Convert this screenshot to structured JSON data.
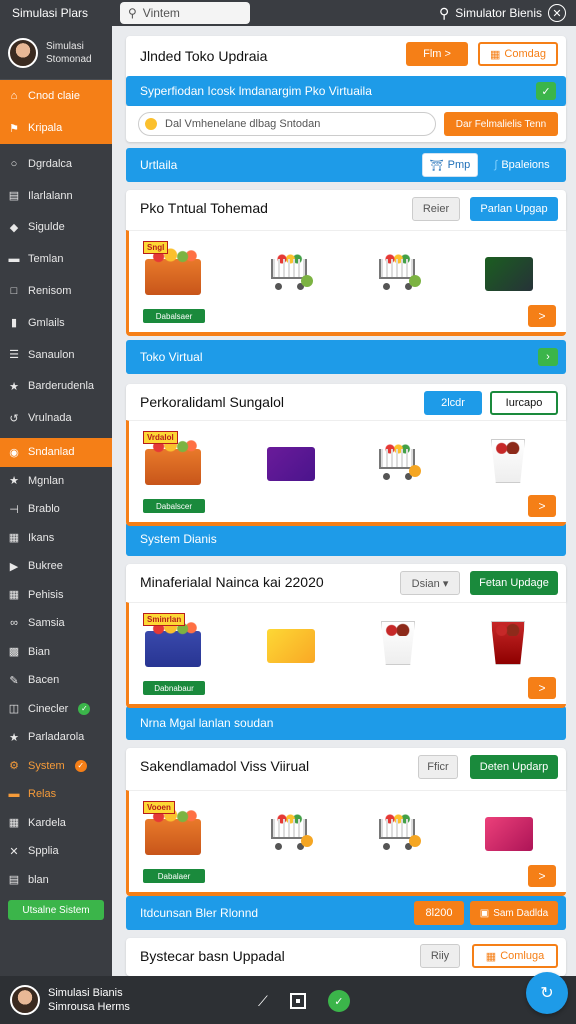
{
  "topbar": {
    "app_title": "Simulasi Plars",
    "search_value": "Vintem",
    "right_label": "Simulator Bienis"
  },
  "sidebar": {
    "profile_name": "Simulasi\nStomonad",
    "items": [
      {
        "label": "Cnod claie",
        "icon": "home-icon",
        "style": "orange"
      },
      {
        "label": "Kripala",
        "icon": "flag-icon",
        "style": "orange"
      },
      {
        "label": "Dgrdalca",
        "icon": "circle-icon",
        "style": ""
      },
      {
        "label": "Ilarlalann",
        "icon": "document-icon",
        "style": ""
      },
      {
        "label": "Sigulde",
        "icon": "tag-icon",
        "style": ""
      },
      {
        "label": "Temlan",
        "icon": "card-icon",
        "style": ""
      },
      {
        "label": "Renisom",
        "icon": "square-icon",
        "style": ""
      },
      {
        "label": "Gmlails",
        "icon": "bars-icon",
        "style": ""
      },
      {
        "label": "Sanaulon",
        "icon": "list-icon",
        "style": ""
      },
      {
        "label": "Barderudenla",
        "icon": "star-icon",
        "style": ""
      },
      {
        "label": "Vrulnada",
        "icon": "share-icon",
        "style": ""
      },
      {
        "label": "Sndanlad",
        "icon": "shield-icon",
        "style": "orange-sel"
      },
      {
        "label": "Mgnlan",
        "icon": "star-icon",
        "style": ""
      },
      {
        "label": "Brablo",
        "icon": "bracket-icon",
        "style": ""
      },
      {
        "label": "Ikans",
        "icon": "building-icon",
        "style": ""
      },
      {
        "label": "Bukree",
        "icon": "play-icon",
        "style": ""
      },
      {
        "label": "Pehisis",
        "icon": "grid-icon",
        "style": ""
      },
      {
        "label": "Samsia",
        "icon": "link-icon",
        "style": ""
      },
      {
        "label": "Bian",
        "icon": "chart-icon",
        "style": ""
      },
      {
        "label": "Bacen",
        "icon": "edit-icon",
        "style": ""
      },
      {
        "label": "Cinecler",
        "icon": "window-icon",
        "style": "green-dot"
      },
      {
        "label": "Parladarola",
        "icon": "star-icon",
        "style": ""
      },
      {
        "label": "System",
        "icon": "gear-icon",
        "style": "orange-dot"
      },
      {
        "label": "Relas",
        "icon": "card-icon",
        "style": "orange-text"
      },
      {
        "label": "Kardela",
        "icon": "building-icon",
        "style": ""
      },
      {
        "label": "Spplia",
        "icon": "x-icon",
        "style": ""
      },
      {
        "label": "blan",
        "icon": "document-icon",
        "style": ""
      }
    ],
    "bottom_button": "Utsalne Sistem"
  },
  "header_card": {
    "title": "Jlnded Toko Updraia",
    "btn_film": "Flm  >",
    "btn_comdag": "Comdag",
    "banner": "Syperfiodan Icosk lmdanargim Pko Virtuaila",
    "input_placeholder": "Dal Vmhenelane dlbag Sntodan",
    "input_button": "Dar Felmalielis Tenn"
  },
  "sections": [
    {
      "bar": "Urtlaila",
      "bar_btn1": "Pmp",
      "bar_btn2": "Bpaleions",
      "title": "Pko Tntual Tohemad",
      "btn_a": "Reier",
      "btn_b": "Parlan Upgap",
      "crate_tag": "Sngl",
      "label": "Dabalsaer",
      "next": ">"
    },
    {
      "bar": "Toko Virtual",
      "bar_btn1": "",
      "bar_btn2": "",
      "title": "Perkoralidaml Sungalol",
      "btn_a": "2lcdr",
      "btn_b": "Iurcapo",
      "crate_tag": "Vrdalol",
      "label": "Dabalscer",
      "next": ">"
    },
    {
      "bar": "System Dianis",
      "bar_btn1": "",
      "bar_btn2": "",
      "title": "Minaferialal Nainca kai 22020",
      "btn_a": "Dsian  ▾",
      "btn_b": "Fetan Updage",
      "crate_tag": "Sminrlan",
      "label": "Dabnabaur",
      "next": ">"
    },
    {
      "bar": "Nrna Mgal lanlan soudan",
      "bar_btn1": "",
      "bar_btn2": "",
      "title": "Sakendlamadol Viss Viirual",
      "btn_a": "Fficr",
      "btn_b": "Deten Updarp",
      "crate_tag": "Vooen",
      "label": "Dabalaer",
      "next": ">"
    }
  ],
  "footer_bar": {
    "label": "Itdcunsan Bler Rlonnd",
    "value": "8l200",
    "btn": "Sam Dadlda"
  },
  "last_card": {
    "title": "Bystecar basn Uppadal",
    "btn_a": "Riiy",
    "btn_b": "Comluga"
  },
  "bottom": {
    "profile_name": "Simulasi Bianis\nSimrousa  Herms"
  }
}
